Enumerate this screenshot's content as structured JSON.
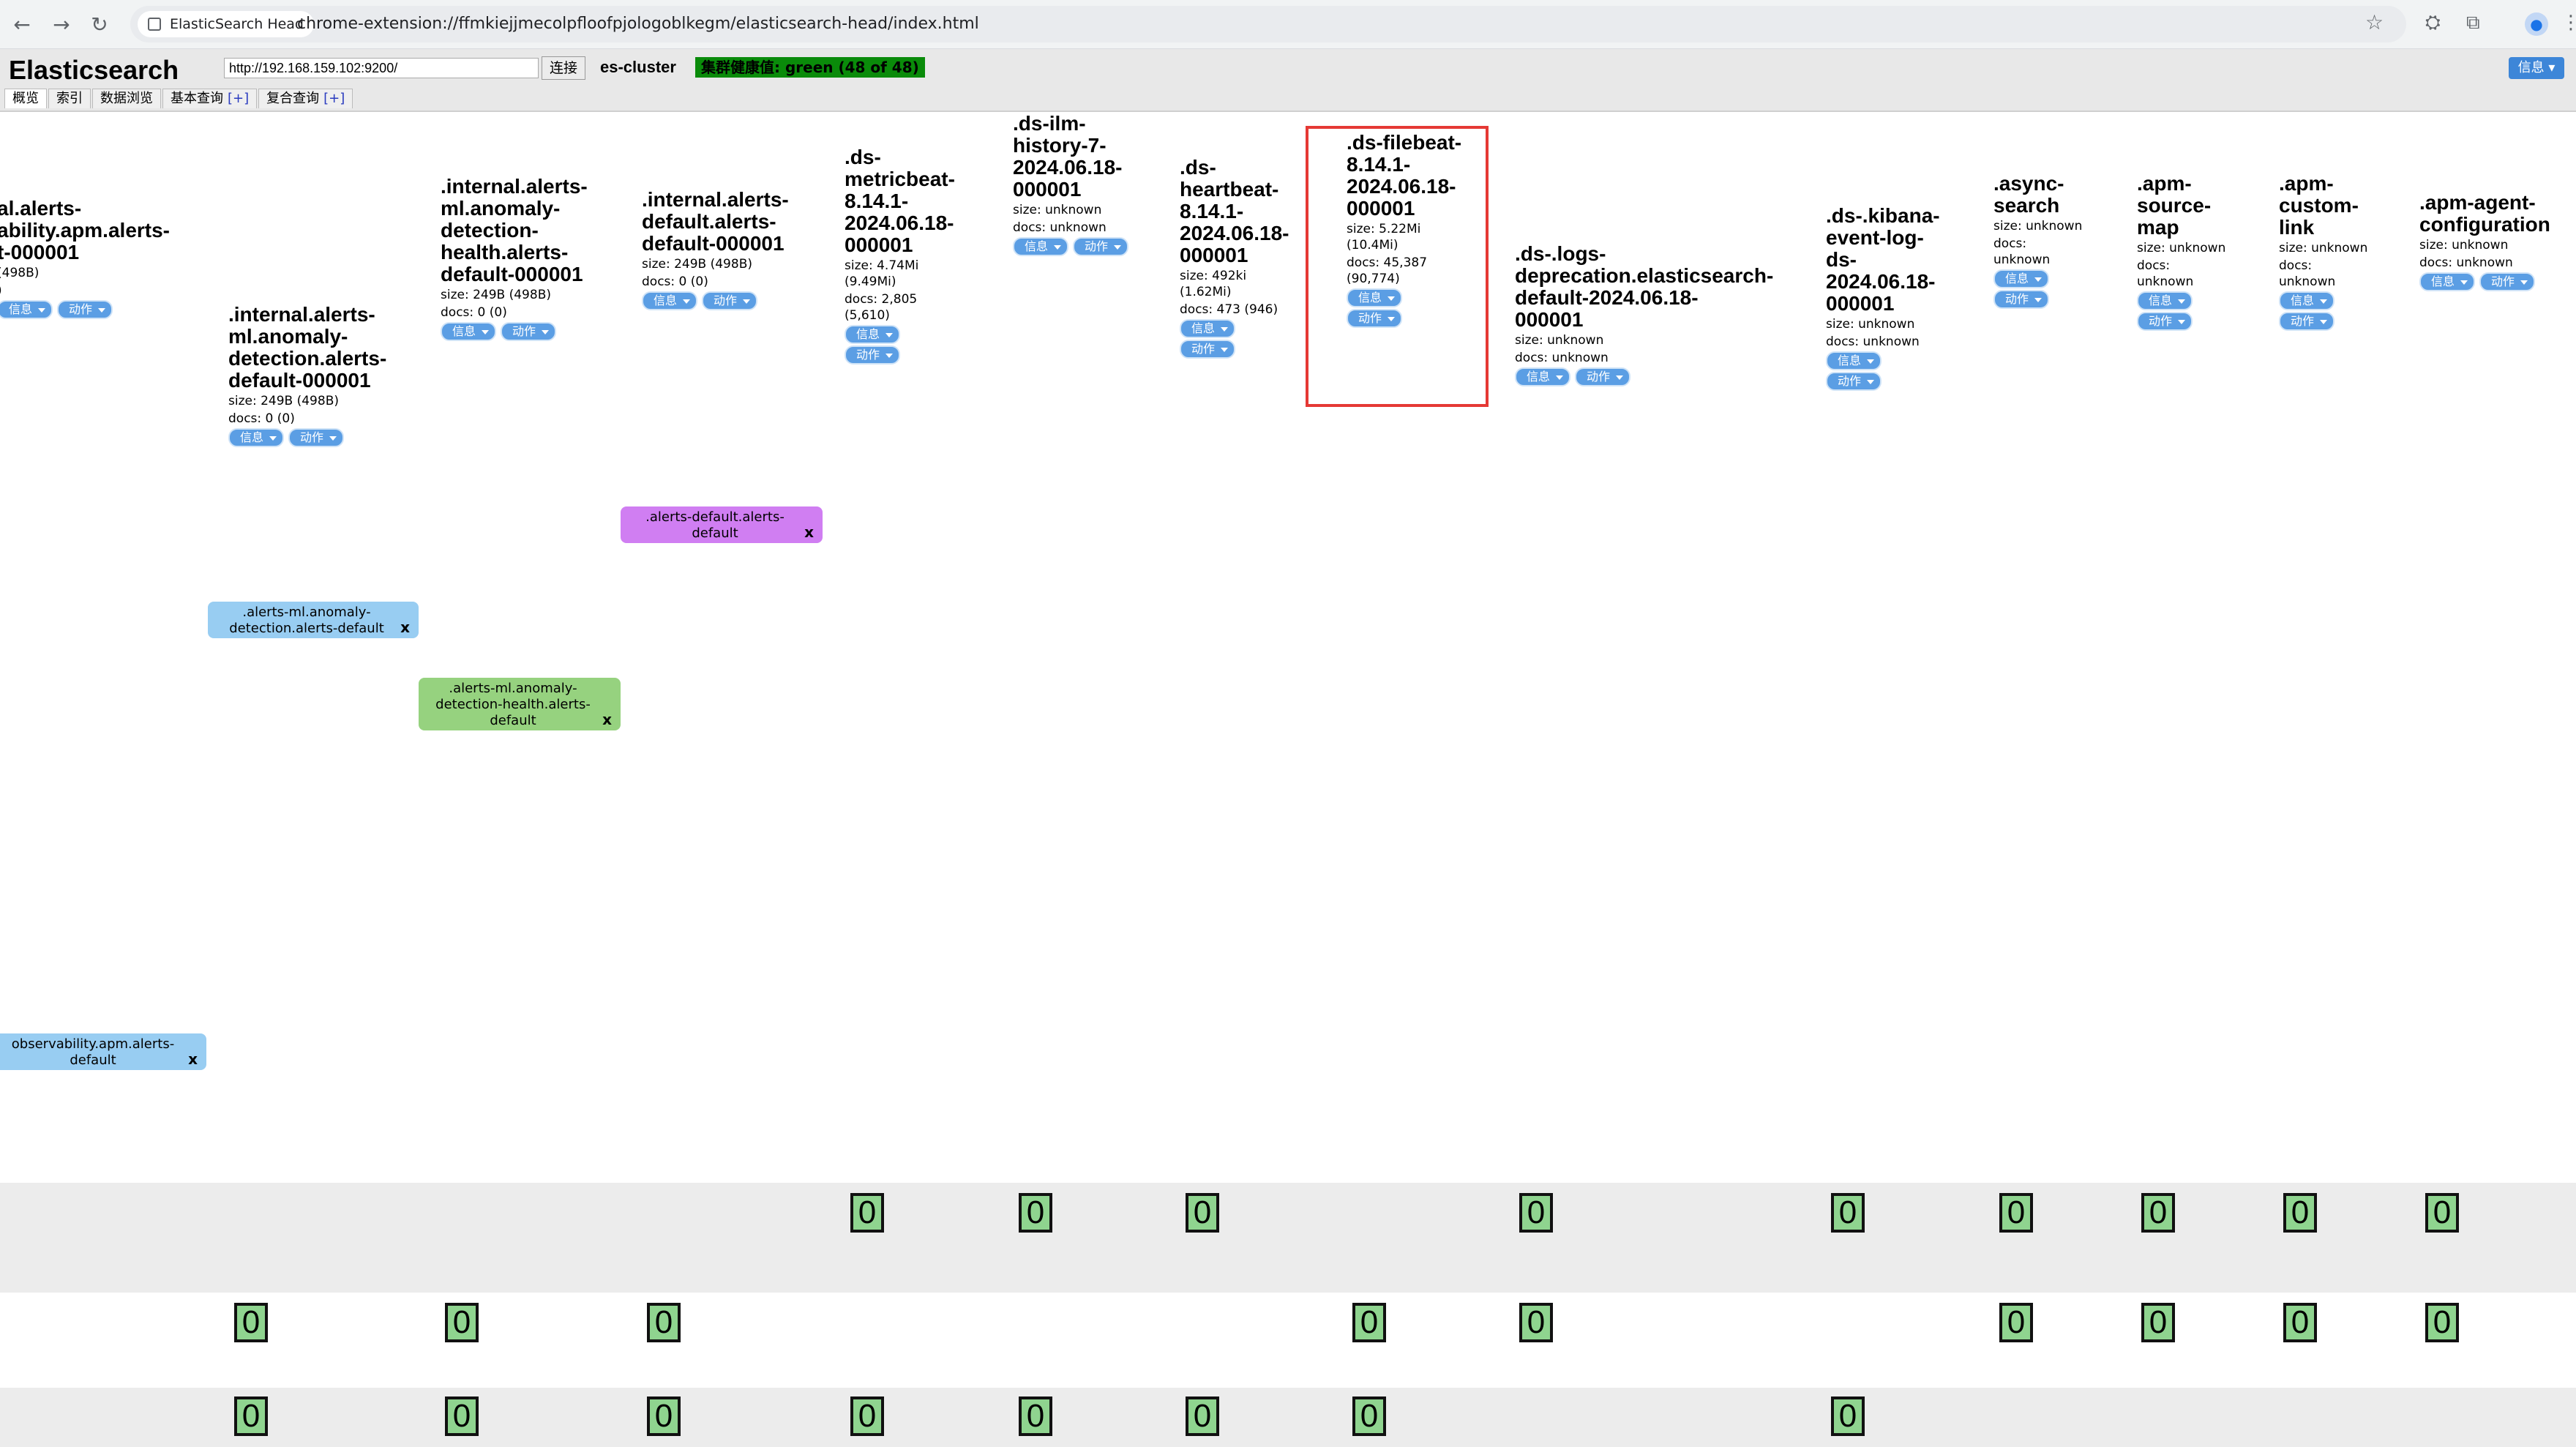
{
  "browser": {
    "tab_title": "ElasticSearch Head",
    "url": "chrome-extension://ffmkiejjmecolpfloofpjologoblkegm/elasticsearch-head/index.html"
  },
  "app": {
    "title": "Elasticsearch",
    "connect_url": "http://192.168.159.102:9200/",
    "connect_label": "连接",
    "cluster_name": "es-cluster",
    "health": "集群健康值: green (48 of 48)",
    "info_menu": "信息",
    "health_color": "#0a8b0a"
  },
  "tabs": [
    {
      "label": "概览"
    },
    {
      "label": "索引"
    },
    {
      "label": "数据浏览"
    },
    {
      "label": "基本查询",
      "plus": "[+]"
    },
    {
      "label": "复合查询",
      "plus": "[+]"
    }
  ],
  "buttons": {
    "info": "信息",
    "action": "动作"
  },
  "indices": [
    {
      "name": "al.alerts-\nability.apm.alerts-\nt-000001",
      "size": "(498B)",
      "docs": ")"
    },
    {
      "name": ".internal.alerts-\nml.anomaly-\ndetection.alerts-\ndefault-000001",
      "size": "size: 249B (498B)",
      "docs": "docs: 0 (0)"
    },
    {
      "name": ".internal.alerts-\nml.anomaly-\ndetection-\nhealth.alerts-\ndefault-000001",
      "size": "size: 249B (498B)",
      "docs": "docs: 0 (0)"
    },
    {
      "name": ".internal.alerts-\ndefault.alerts-\ndefault-000001",
      "size": "size: 249B (498B)",
      "docs": "docs: 0 (0)"
    },
    {
      "name": ".ds-\nmetricbeat-\n8.14.1-\n2024.06.18-\n000001",
      "size": "size: 4.74Mi\n(9.49Mi)",
      "docs": "docs: 2,805\n(5,610)"
    },
    {
      "name": ".ds-ilm-\nhistory-7-\n2024.06.18-\n000001",
      "size": "size: unknown",
      "docs": "docs: unknown"
    },
    {
      "name": ".ds-\nheartbeat-\n8.14.1-\n2024.06.18-\n000001",
      "size": "size: 492ki\n(1.62Mi)",
      "docs": "docs: 473 (946)"
    },
    {
      "name": ".ds-filebeat-\n8.14.1-\n2024.06.18-\n000001",
      "size": "size: 5.22Mi\n(10.4Mi)",
      "docs": "docs: 45,387\n(90,774)"
    },
    {
      "name": ".ds-.logs-\ndeprecation.elasticsearch-\ndefault-2024.06.18-\n000001",
      "size": "size: unknown",
      "docs": "docs: unknown"
    },
    {
      "name": ".ds-.kibana-\nevent-log-\nds-\n2024.06.18-\n000001",
      "size": "size: unknown",
      "docs": "docs: unknown"
    },
    {
      "name": ".async-\nsearch",
      "size": "size: unknown",
      "docs": "docs:\nunknown"
    },
    {
      "name": ".apm-\nsource-\nmap",
      "size": "size: unknown",
      "docs": "docs:\nunknown"
    },
    {
      "name": ".apm-\ncustom-\nlink",
      "size": "size: unknown",
      "docs": "docs:\nunknown"
    },
    {
      "name": ".apm-agent-\nconfiguration",
      "size": "size: unknown",
      "docs": "docs: unknown"
    }
  ],
  "aliases": [
    {
      "text": ".alerts-default.alerts-\ndefault",
      "close": "x",
      "color": "#d07ef2"
    },
    {
      "text": ".alerts-ml.anomaly-\ndetection.alerts-default",
      "close": "x",
      "color": "#98cdf2"
    },
    {
      "text": ".alerts-ml.anomaly-\ndetection-health.alerts-\ndefault",
      "close": "x",
      "color": "#96d27f"
    },
    {
      "text": "observability.apm.alerts-\ndefault",
      "close": "x",
      "color": "#98cdf2"
    }
  ],
  "shard_label": "0",
  "highlight_color": "#e53935"
}
